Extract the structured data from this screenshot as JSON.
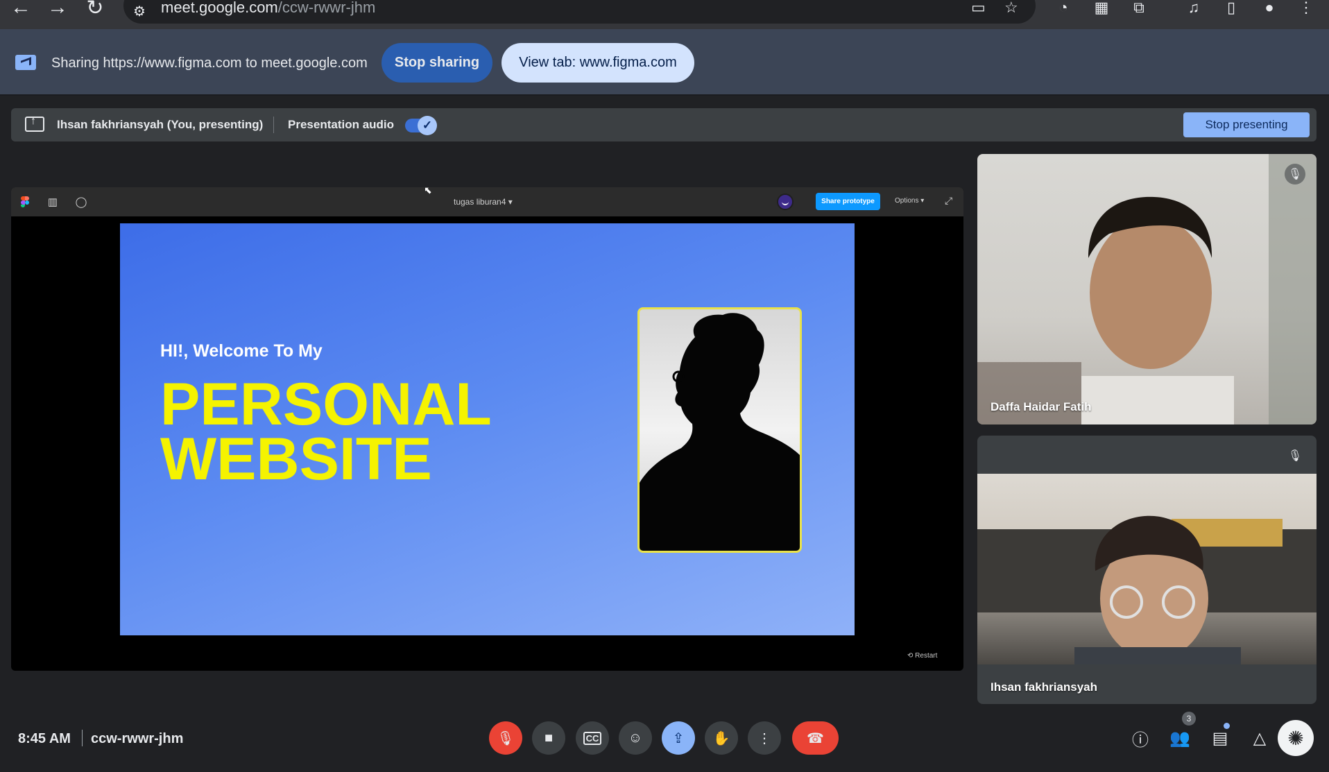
{
  "browser": {
    "url_host": "meet.google.com",
    "url_path": "/ccw-rwwr-jhm"
  },
  "share_bar": {
    "message": "Sharing https://www.figma.com to meet.google.com",
    "stop_label": "Stop sharing",
    "view_tab_label": "View tab: www.figma.com"
  },
  "present_bar": {
    "presenter": "Ihsan fakhriansyah (You, presenting)",
    "audio_label": "Presentation audio",
    "audio_on": true,
    "stop_label": "Stop presenting"
  },
  "figma": {
    "file_name": "tugas liburan4",
    "share_label": "Share prototype",
    "options_label": "Options",
    "restart_label": "Restart",
    "slide": {
      "welcome": "HI!, Welcome To My",
      "headline_line1": "PERSONAL",
      "headline_line2": "WEBSITE"
    }
  },
  "participants": [
    {
      "name": "Daffa Haidar Fatih",
      "muted": true
    },
    {
      "name": "Ihsan fakhriansyah",
      "muted": true
    }
  ],
  "bottom_bar": {
    "time": "8:45 AM",
    "meeting_code": "ccw-rwwr-jhm",
    "people_count": "3"
  },
  "colors": {
    "accent_blue": "#8ab4f8",
    "end_call_red": "#ea4335",
    "slide_yellow": "#f5f300",
    "figma_blue": "#0d99ff"
  }
}
